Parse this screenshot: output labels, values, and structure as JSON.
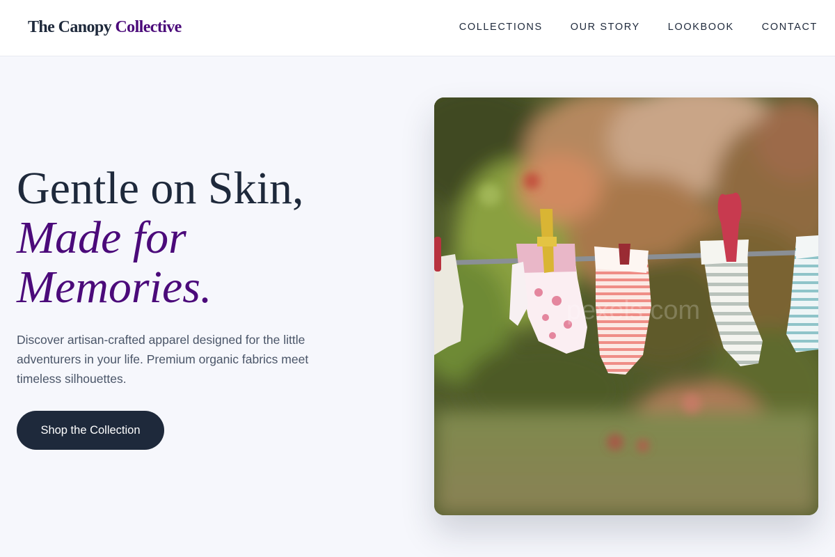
{
  "brand": {
    "name_part1": "The Canopy",
    "name_part2": "Collective",
    "accent_color": "#4b0a7a"
  },
  "nav": {
    "items": [
      {
        "label": "COLLECTIONS"
      },
      {
        "label": "OUR STORY"
      },
      {
        "label": "LOOKBOOK"
      },
      {
        "label": "CONTACT"
      }
    ]
  },
  "hero": {
    "headline_line1": "Gentle on Skin,",
    "headline_line2": "Made for",
    "headline_line3": "Memories.",
    "description": "Discover artisan-crafted apparel designed for the little adventurers in your life. Premium organic fabrics meet timeless silhouettes.",
    "cta_label": "Shop the Collection",
    "image_subject": "baby-socks-on-clothesline-photo"
  },
  "colors": {
    "primary_dark": "#1e293b",
    "page_background": "#f6f7fc",
    "body_text": "#4a5568"
  }
}
